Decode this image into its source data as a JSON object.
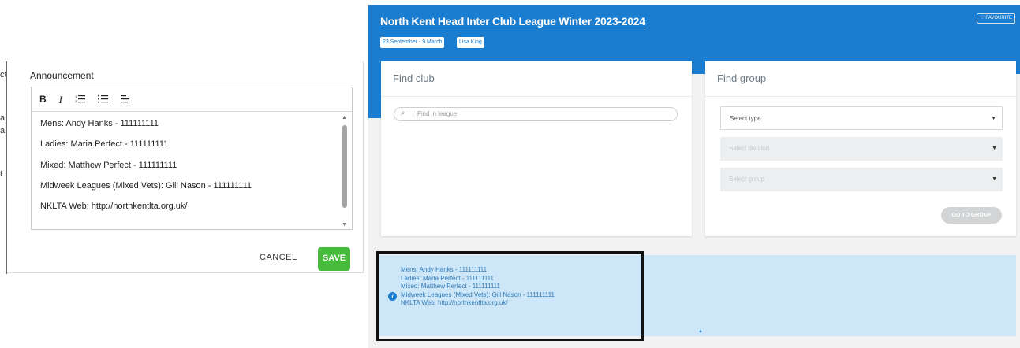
{
  "editor": {
    "title": "Announcement",
    "toolbar": {
      "bold": "B",
      "italic": "I",
      "ordered_list": "☰",
      "unordered_list": "☰",
      "align": "≡"
    },
    "lines": [
      "Mens: Andy Hanks - 111111111",
      "Ladies: Maria Perfect - 111111111",
      "Mixed: Matthew Perfect - 111111111",
      "Midweek Leagues (Mixed Vets): Gill Nason - 111111111",
      "NKLTA Web: http://northkentlta.org.uk/"
    ],
    "cancel_label": "CANCEL",
    "save_label": "SAVE",
    "save_color": "#47bb3c"
  },
  "left_fragments": [
    "ct",
    "a",
    "a",
    "t"
  ],
  "league": {
    "title": "North Kent Head Inter Club League Winter 2023-2024",
    "dates": "23 September - 9 March",
    "organiser": "Lisa King",
    "favourite_label": "♡ FAVOURITE",
    "header_color": "#1a7dcf"
  },
  "find_club": {
    "title": "Find club",
    "search_placeholder": "Find in league"
  },
  "find_group": {
    "title": "Find group",
    "type_placeholder": "Select type",
    "division_placeholder": "Select division",
    "group_placeholder": "Select group",
    "go_label": "GO TO GROUP"
  },
  "announcement": {
    "lines": [
      "Mens: Andy Hanks - 111111111",
      "Ladies: Maria Perfect - 111111111",
      "Mixed: Matthew Perfect - 111111111",
      "Midweek Leagues (Mixed Vets): Gill Nason - 111111111",
      "NKLTA Web: http://northkentlta.org.uk/"
    ],
    "box_color": "#cde7f8"
  }
}
